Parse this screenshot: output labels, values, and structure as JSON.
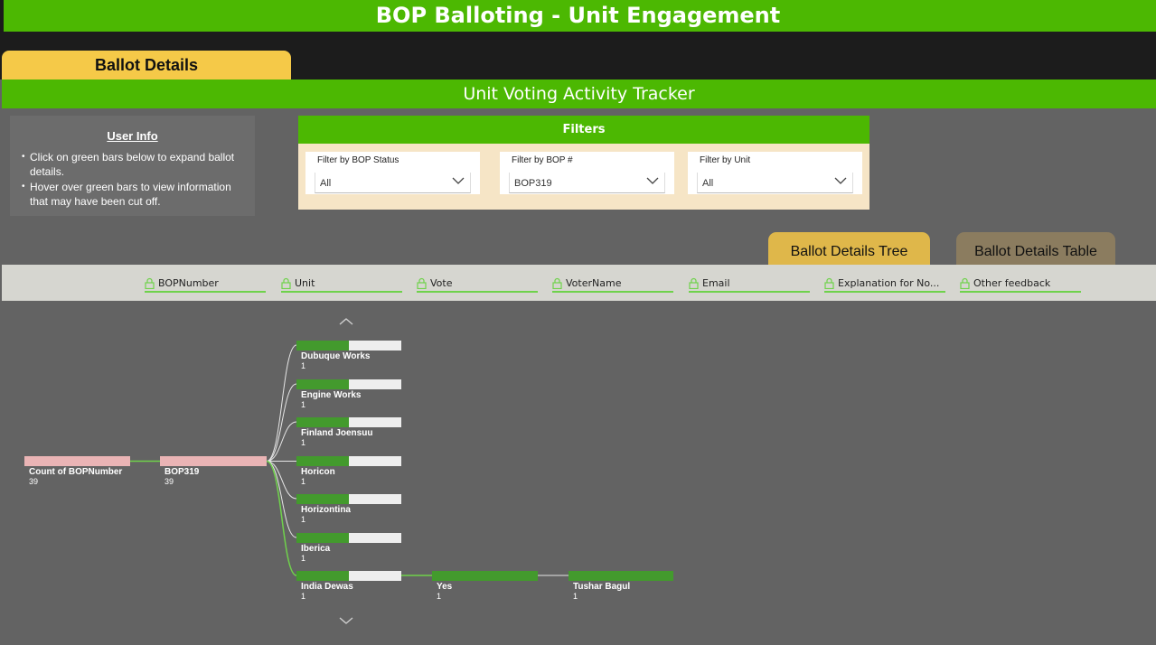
{
  "header": {
    "title": "BOP Balloting - Unit Engagement"
  },
  "tabs": {
    "ballot_details": "Ballot Details"
  },
  "tracker": {
    "title": "Unit Voting Activity Tracker"
  },
  "user_info": {
    "title": "User Info",
    "tips": [
      "Click on green bars below to expand ballot details.",
      "Hover over green bars to view information that may have been cut off."
    ]
  },
  "filters": {
    "title": "Filters",
    "slicers": [
      {
        "label": "Filter by BOP Status",
        "value": "All"
      },
      {
        "label": "Filter by BOP #",
        "value": "BOP319"
      },
      {
        "label": "Filter by Unit",
        "value": "All"
      }
    ]
  },
  "views": {
    "tree": "Ballot Details Tree",
    "table": "Ballot Details Table"
  },
  "fields": [
    "BOPNumber",
    "Unit",
    "Vote",
    "VoterName",
    "Email",
    "Explanation for No...",
    "Other feedback"
  ],
  "tree": {
    "root": {
      "label": "Count of BOPNumber",
      "value": "39"
    },
    "level1": {
      "label": "BOP319",
      "value": "39"
    },
    "units": [
      {
        "label": "Dubuque Works",
        "value": "1",
        "fill": 0.5
      },
      {
        "label": "Engine Works",
        "value": "1",
        "fill": 0.5
      },
      {
        "label": "Finland Joensuu",
        "value": "1",
        "fill": 0.5
      },
      {
        "label": "Horicon",
        "value": "1",
        "fill": 0.5
      },
      {
        "label": "Horizontina",
        "value": "1",
        "fill": 0.5
      },
      {
        "label": "Iberica",
        "value": "1",
        "fill": 0.5
      },
      {
        "label": "India Dewas",
        "value": "1",
        "fill": 0.5
      }
    ],
    "vote": {
      "label": "Yes",
      "value": "1"
    },
    "voter": {
      "label": "Tushar Bagul",
      "value": "1"
    }
  },
  "colors": {
    "brand_green": "#4cb802",
    "bar_green": "#439a2d",
    "root_pink": "#eab4b5",
    "tab_gold": "#f5c948"
  }
}
